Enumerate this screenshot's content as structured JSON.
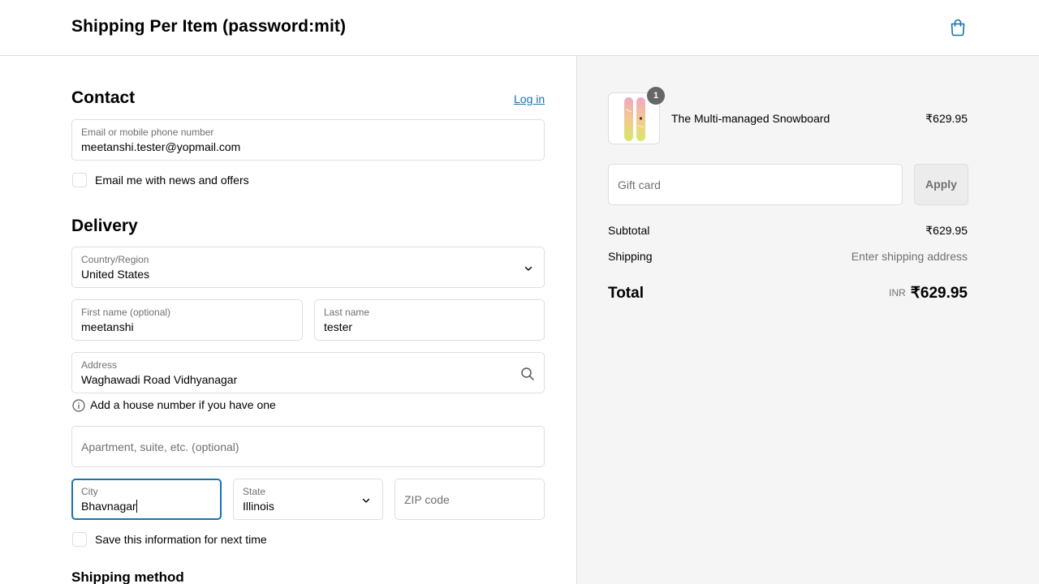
{
  "header": {
    "store_title": "Shipping Per Item (password:mit)"
  },
  "contact": {
    "title": "Contact",
    "login_link": "Log in",
    "email_label": "Email or mobile phone number",
    "email_value": "meetanshi.tester@yopmail.com",
    "newsletter_label": "Email me with news and offers"
  },
  "delivery": {
    "title": "Delivery",
    "country_label": "Country/Region",
    "country_value": "United States",
    "first_name_label": "First name (optional)",
    "first_name_value": "meetanshi",
    "last_name_label": "Last name",
    "last_name_value": "tester",
    "address_label": "Address",
    "address_value": "Waghawadi Road Vidhyanagar",
    "house_number_hint": "Add a house number if you have one",
    "apartment_placeholder": "Apartment, suite, etc. (optional)",
    "city_label": "City",
    "city_value": "Bhavnagar",
    "state_label": "State",
    "state_value": "Illinois",
    "zip_placeholder": "ZIP code",
    "save_info_label": "Save this information for next time"
  },
  "shipping_method": {
    "title": "Shipping method"
  },
  "summary": {
    "product_name": "The Multi-managed Snowboard",
    "product_price": "₹629.95",
    "quantity_badge": "1",
    "gift_card_placeholder": "Gift card",
    "apply_label": "Apply",
    "subtotal_label": "Subtotal",
    "subtotal_value": "₹629.95",
    "shipping_label": "Shipping",
    "shipping_value": "Enter shipping address",
    "total_label": "Total",
    "total_currency": "INR",
    "total_value": "₹629.95"
  },
  "colors": {
    "link": "#1773b0",
    "focus_border": "#1773b0",
    "summary_bg": "#f5f5f5",
    "border": "#dedede"
  }
}
